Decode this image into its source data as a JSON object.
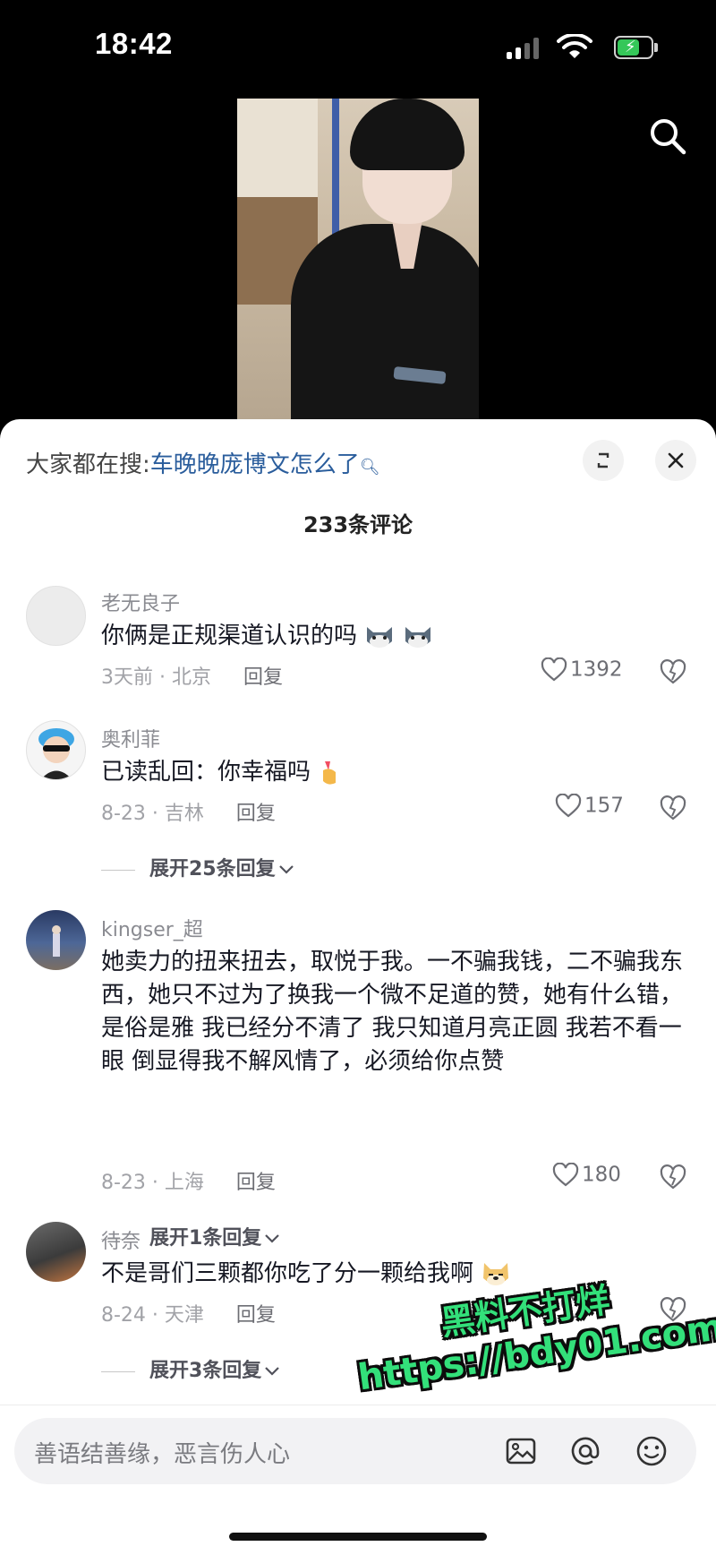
{
  "status_bar": {
    "time": "18:42"
  },
  "search_bar": {
    "prefix": "大家都在搜:",
    "query": "车晚晚庞博文怎么了"
  },
  "comments_header": {
    "count_label": "233条评论"
  },
  "comments": [
    {
      "author": "老无良子",
      "text": "你俩是正规渠道认识的吗",
      "time_location": "3天前 · 北京",
      "reply_label": "回复",
      "likes": "1392",
      "emoji_icons": [
        "cat-face-icon",
        "cat-face-icon"
      ]
    },
    {
      "author": "奥利菲",
      "text": "已读乱回：你幸福吗",
      "time_location": "8-23 · 吉林",
      "reply_label": "回复",
      "likes": "157",
      "expand_label": "展开25条回复",
      "emoji_icons": [
        "finger-heart-icon"
      ]
    },
    {
      "author": "kingser_超",
      "text": "她卖力的扭来扭去，取悦于我。一不骗我钱，二不骗我东西，她只不过为了换我一个微不足道的赞，她有什么错，是俗是雅 我已经分不清了 我只知道月亮正圆 我若不看一眼 倒显得我不解风情了，必须给你点赞",
      "time_location": "8-23 · 上海",
      "reply_label": "回复",
      "likes": "180",
      "expand_label": "展开1条回复"
    },
    {
      "author": "待奈",
      "text": "不是哥们三颗都你吃了分一颗给我啊",
      "time_location": "8-24 · 天津",
      "reply_label": "回复",
      "likes": "",
      "expand_label": "展开3条回复",
      "emoji_icons": [
        "doge-icon"
      ]
    }
  ],
  "watermark": {
    "line1": "黑料不打烊",
    "line2": "https://bdy01.com"
  },
  "input": {
    "placeholder": "善语结善缘，恶言伤人心"
  },
  "colors": {
    "link": "#2a5d9c",
    "watermark": "#33e07a",
    "battery": "#35c759"
  },
  "icons": [
    "search-icon",
    "expand-icon",
    "close-icon",
    "heart-icon",
    "dislike-icon",
    "image-icon",
    "at-icon",
    "emoji-icon"
  ]
}
